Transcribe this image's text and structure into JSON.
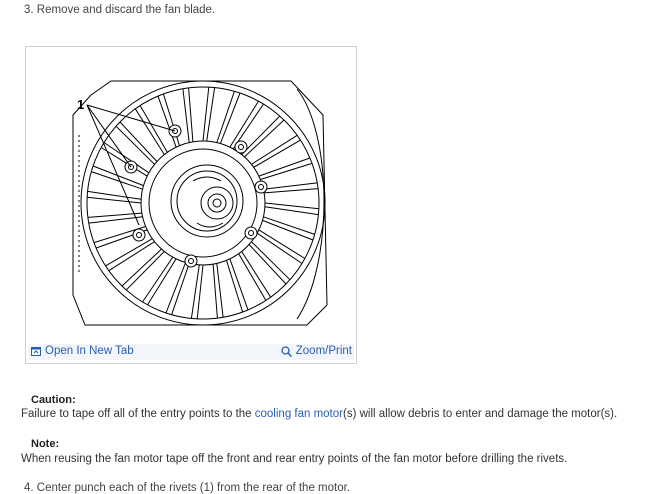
{
  "steps": {
    "step3": "3. Remove and discard the fan blade.",
    "step4": "4. Center punch each of the rivets (1) from the rear of the motor."
  },
  "figure": {
    "callout": "1",
    "open_tab_label": "Open In New Tab",
    "zoom_label": "Zoom/Print",
    "open_icon": "open-in-new-tab-icon",
    "zoom_icon": "magnifier-icon"
  },
  "caution": {
    "label": "Caution:",
    "text_before": "Failure to tape off all of the entry points to the ",
    "link": "cooling fan motor",
    "text_after": "(s) will allow debris to enter and damage the motor(s)."
  },
  "note": {
    "label": "Note:",
    "text": "When reusing the fan motor tape off the front and rear entry points of the fan motor before drilling the rivets."
  },
  "colors": {
    "link": "#2a5db0",
    "bar_bg": "#f2f5f9",
    "border": "#cfcfcf"
  }
}
